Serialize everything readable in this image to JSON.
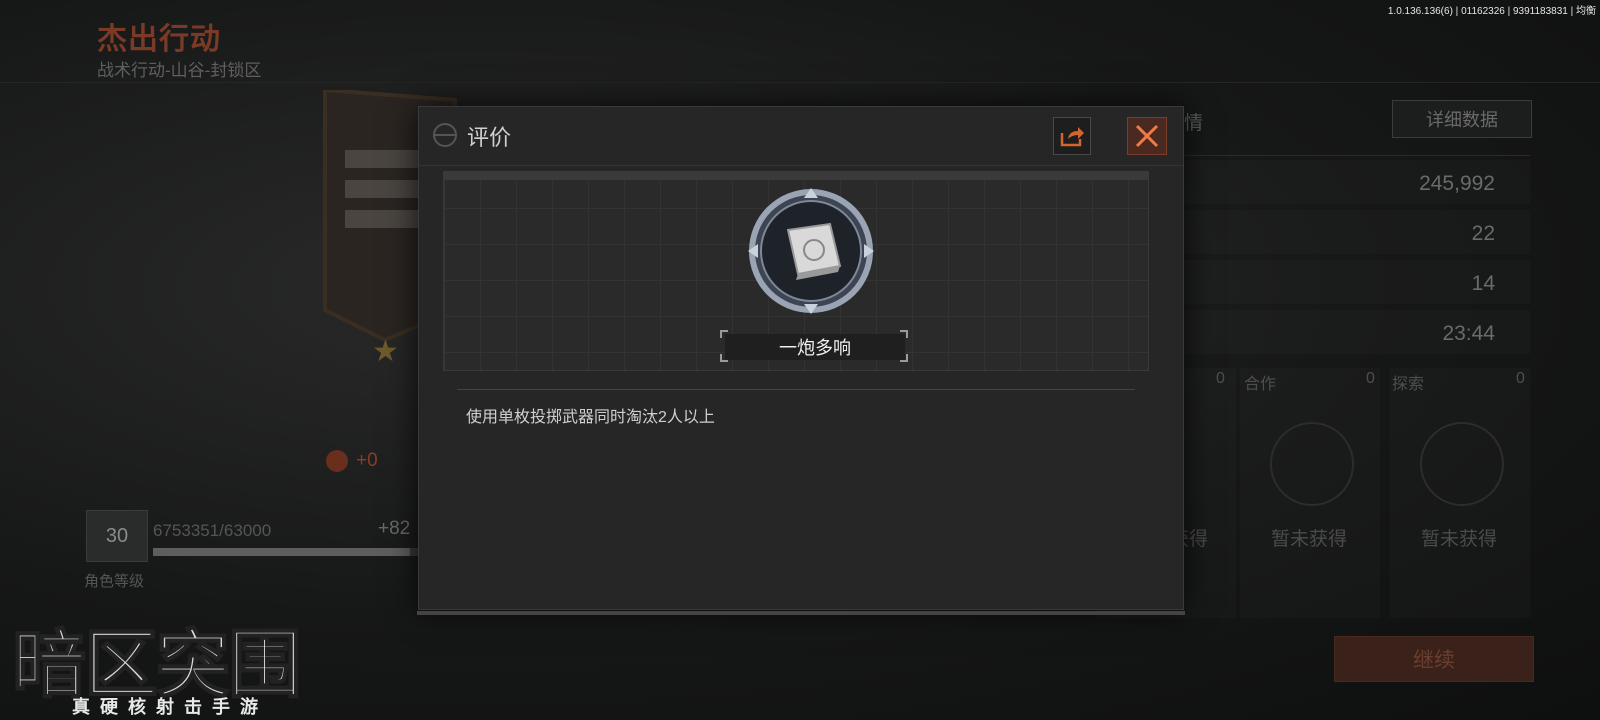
{
  "version": "1.0.136.136(6) | 01162326 | 9391183831 | 均衡",
  "header": {
    "title": "杰出行动",
    "subtitle": "战术行动-山谷-封锁区"
  },
  "left": {
    "reward": "+0",
    "level": "30",
    "exp_text": "6753351/63000",
    "exp_gain": "+82",
    "exp_progress": 0.95,
    "level_label": "角色等级"
  },
  "right": {
    "title": "详情",
    "detail_button": "详细数据",
    "values": [
      "245,992",
      "22",
      "14",
      "23:44"
    ],
    "categories": [
      {
        "label": "",
        "count": "0",
        "status": "获得"
      },
      {
        "label": "合作",
        "count": "0",
        "status": "暂未获得"
      },
      {
        "label": "探索",
        "count": "0",
        "status": "暂未获得"
      }
    ],
    "continue_button": "继续"
  },
  "modal": {
    "title": "评价",
    "share_icon": "share-icon",
    "close_icon": "close-icon",
    "medal_name": "一炮多响",
    "description": "使用单枚投掷武器同时淘汰2人以上"
  },
  "logo": {
    "main": "暗区突围",
    "sub": "真硬核射击手游"
  },
  "colors": {
    "accent": "#d2652e",
    "close_bg": "#4a2a20"
  }
}
